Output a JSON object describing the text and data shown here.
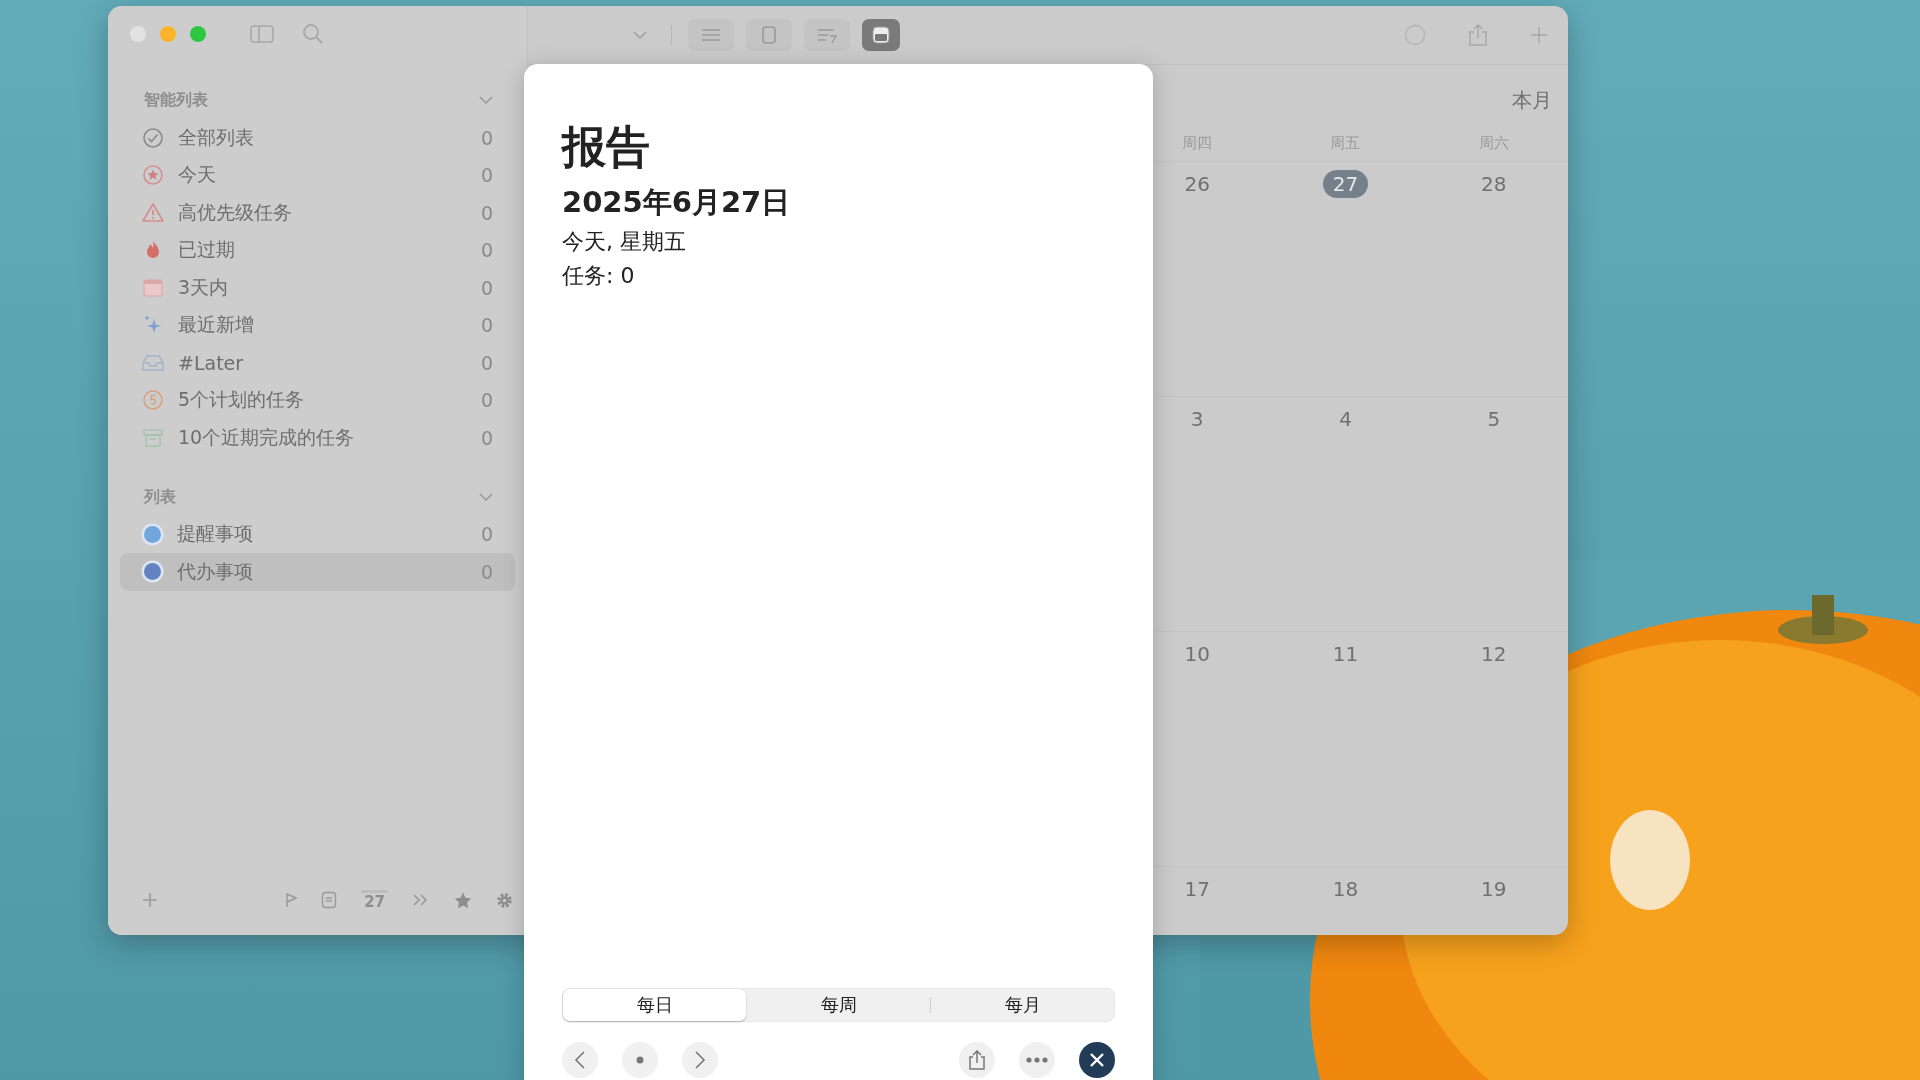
{
  "toolbar": {
    "view_modes": [
      {
        "kind": "list",
        "selected": false
      },
      {
        "kind": "card",
        "selected": false
      },
      {
        "kind": "sort",
        "selected": false
      },
      {
        "kind": "calendar",
        "selected": true
      }
    ]
  },
  "sidebar": {
    "smart_lists_title": "智能列表",
    "smart_lists": [
      {
        "kind": "check",
        "label": "全部列表",
        "count": "0"
      },
      {
        "kind": "star",
        "label": "今天",
        "count": "0"
      },
      {
        "kind": "warning",
        "label": "高优先级任务",
        "count": "0"
      },
      {
        "kind": "flame",
        "label": "已过期",
        "count": "0"
      },
      {
        "kind": "calendar",
        "label": "3天内",
        "count": "0"
      },
      {
        "kind": "sparkle",
        "label": "最近新增",
        "count": "0"
      },
      {
        "kind": "inbox",
        "label": "#Later",
        "count": "0"
      },
      {
        "kind": "five",
        "label": "5个计划的任务",
        "count": "0"
      },
      {
        "kind": "archive",
        "label": "10个近期完成的任务",
        "count": "0"
      }
    ],
    "lists_title": "列表",
    "lists": [
      {
        "label": "提醒事项",
        "count": "0",
        "color": "#72a6de",
        "selected": false
      },
      {
        "label": "代办事项",
        "count": "0",
        "color": "#6482c2",
        "selected": true
      }
    ],
    "footer_day": "27"
  },
  "calendar": {
    "range_label": "本月",
    "weekdays": [
      "周四",
      "周五",
      "周六"
    ],
    "weeks": [
      [
        {
          "day": "26",
          "selected": false
        },
        {
          "day": "27",
          "selected": true
        },
        {
          "day": "28",
          "selected": false
        }
      ],
      [
        {
          "day": "3",
          "selected": false
        },
        {
          "day": "4",
          "selected": false
        },
        {
          "day": "5",
          "selected": false
        }
      ],
      [
        {
          "day": "10",
          "selected": false
        },
        {
          "day": "11",
          "selected": false
        },
        {
          "day": "12",
          "selected": false
        }
      ],
      [
        {
          "day": "17",
          "selected": false
        },
        {
          "day": "18",
          "selected": false
        },
        {
          "day": "19",
          "selected": false
        }
      ]
    ]
  },
  "report": {
    "title": "报告",
    "date": "2025年6月27日",
    "weekday": "今天, 星期五",
    "tasks": "任务: 0",
    "periods": [
      {
        "label": "每日",
        "selected": true
      },
      {
        "label": "每周",
        "selected": false
      },
      {
        "label": "每月",
        "selected": false
      }
    ]
  }
}
